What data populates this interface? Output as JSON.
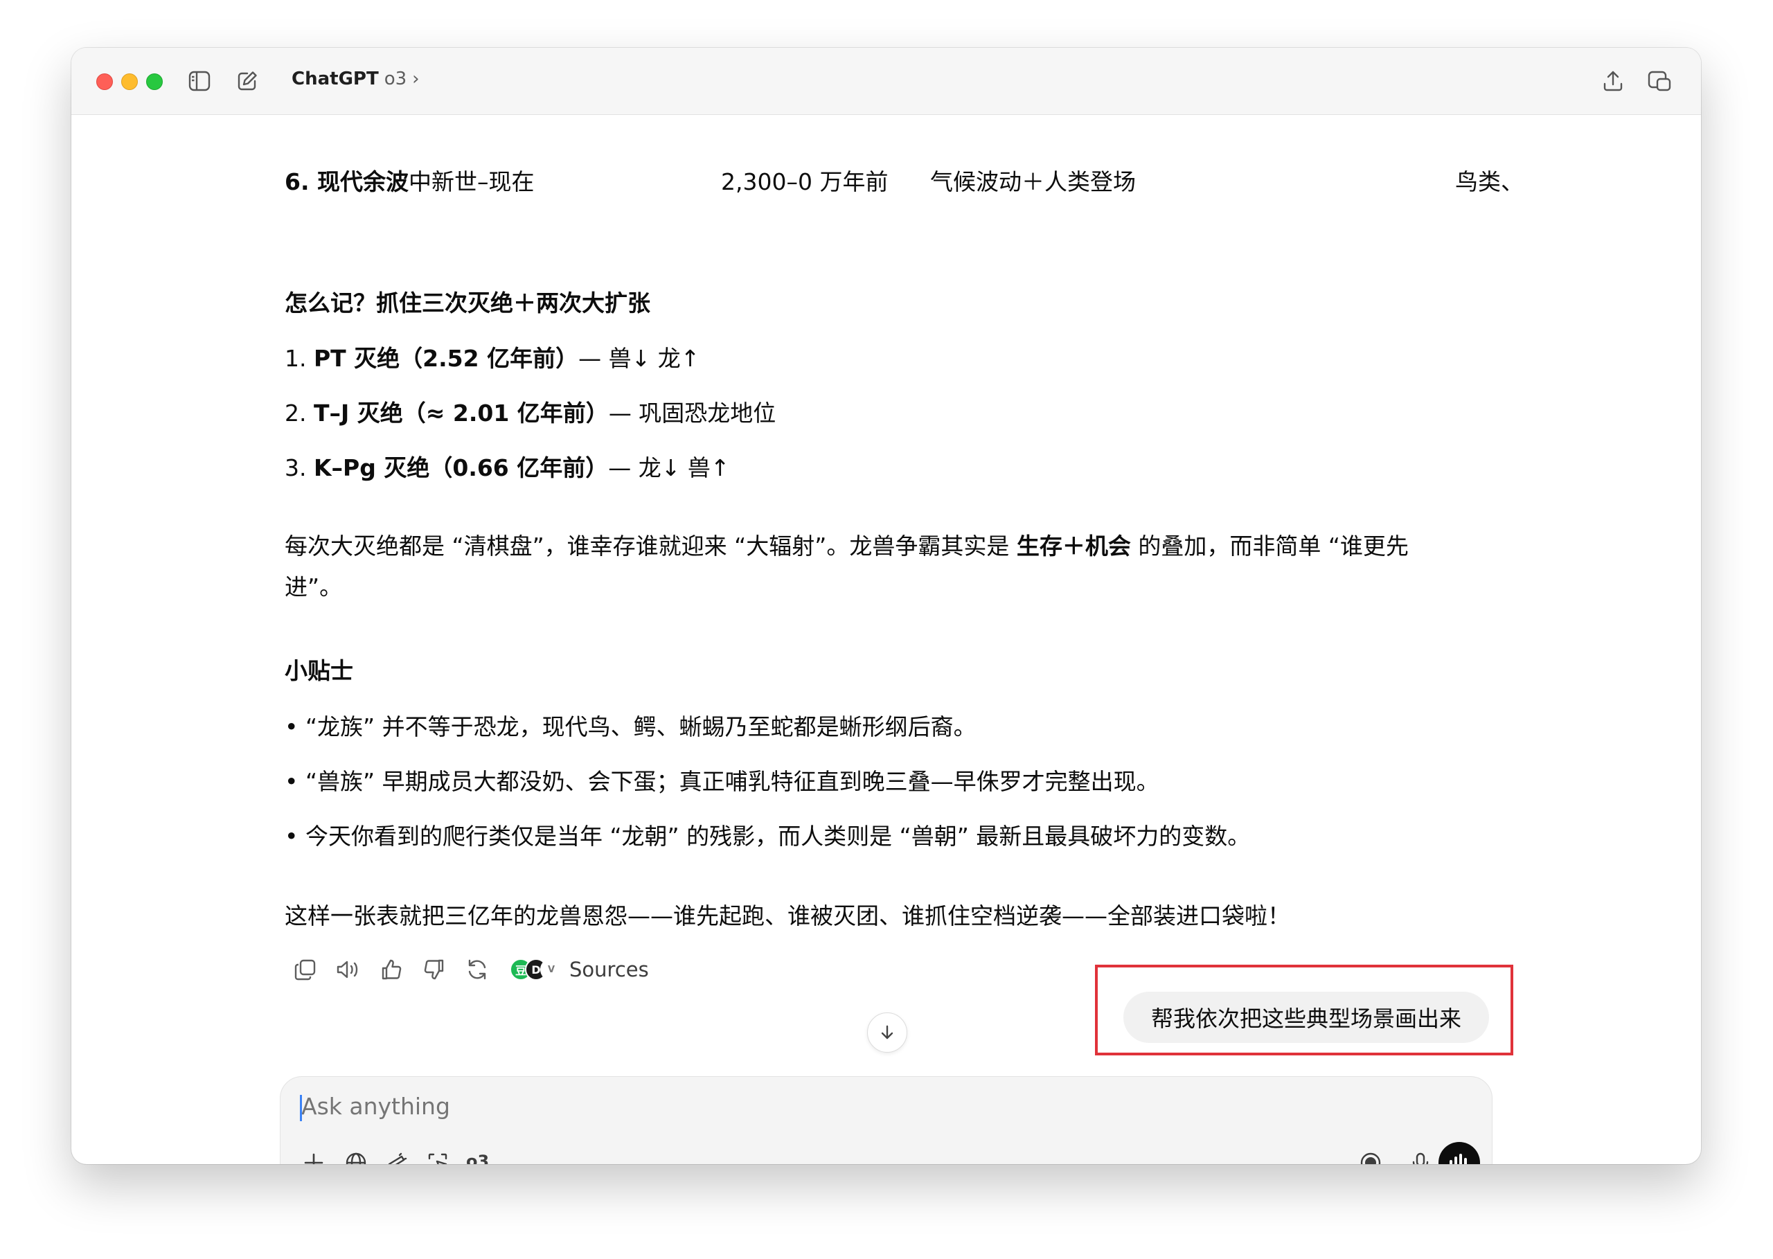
{
  "window": {
    "title": "ChatGPT",
    "model": "o3",
    "chevron": "›"
  },
  "table_last_row": {
    "era": "6. 现代余波",
    "era_rest": "中新世–现在",
    "time": "2,300–0 万年前",
    "driver": "气候波动＋人类登场",
    "winners": "鸟类、"
  },
  "memo": {
    "heading": "怎么记？抓住三次灭绝＋两次大扩张",
    "items": [
      {
        "num": "1. ",
        "bold": "PT 灭绝（2.52 亿年前）",
        "rest": "— 兽↓ 龙↑"
      },
      {
        "num": "2. ",
        "bold": "T–J 灭绝（≈ 2.01 亿年前）",
        "rest": "— 巩固恐龙地位"
      },
      {
        "num": "3. ",
        "bold": "K–Pg 灭绝（0.66 亿年前）",
        "rest": "— 龙↓ 兽↑"
      }
    ]
  },
  "paragraph": {
    "part1": "每次大灭绝都是 “清棋盘”，谁幸存谁就迎来 “大辐射”。龙兽争霸其实是 ",
    "bold": "生存＋机会",
    "part2": " 的叠加，而非简单 “谁更先",
    "line2": "进”。"
  },
  "tips": {
    "heading": "小贴士",
    "items": [
      "• “龙族” 并不等于恐龙，现代鸟、鳄、蜥蜴乃至蛇都是蜥形纲后裔。",
      "• “兽族” 早期成员大都没奶、会下蛋；真正哺乳特征直到晚三叠—早侏罗才完整出现。",
      "• 今天你看到的爬行类仅是当年 “龙朝” 的残影，而人类则是 “兽朝” 最新且最具破坏力的变数。"
    ]
  },
  "closing": "这样一张表就把三亿年的龙兽恩怨——谁先起跑、谁被灭团、谁抓住空档逆袭——全部装进口袋啦！",
  "actions": {
    "sources_label": "Sources",
    "badge_letters": [
      "豆",
      "D",
      "V"
    ]
  },
  "user_message": "帮我依次把这些典型场景画出来",
  "composer": {
    "placeholder": "Ask anything",
    "model_tag": "o3"
  },
  "colors": {
    "highlight": "#e0323a",
    "badge_green": "#1db954",
    "badge_dark": "#1a1a1a"
  }
}
